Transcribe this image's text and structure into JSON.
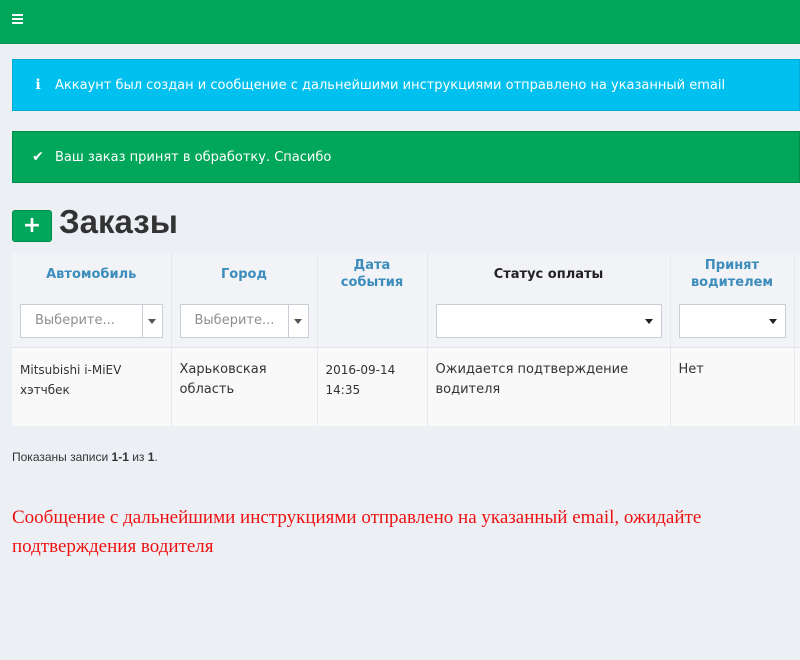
{
  "header": {
    "menu_icon": "hamburger-icon",
    "background": "#00a65a"
  },
  "alerts": {
    "info": {
      "icon": "info-icon",
      "glyph": "ℹ",
      "text": "Аккаунт был создан и сообщение с дальнейшими инструкциями отправлено на указанный email",
      "color": "#00c0ef"
    },
    "success": {
      "icon": "checkmark-icon",
      "glyph": "✔",
      "text": "Ваш заказ принят в обработку. Спасибо",
      "color": "#00a65a"
    }
  },
  "page": {
    "add_glyph": "+",
    "title": "Заказы"
  },
  "table": {
    "columns": [
      {
        "label": "Автомобиль",
        "sortable": true
      },
      {
        "label": "Город",
        "sortable": true
      },
      {
        "label": "Дата события",
        "sortable": true
      },
      {
        "label": "Статус оплаты",
        "sortable": false
      },
      {
        "label": "Принят водителем",
        "sortable": true
      }
    ],
    "filters": {
      "car_placeholder": "Выберите...",
      "city_placeholder": "Выберите...",
      "status_value": "",
      "accepted_value": ""
    },
    "rows": [
      {
        "car": "Mitsubishi i-MiEV хэтчбек",
        "city": "Харьковская область",
        "date": "2016-09-14 14:35",
        "status": "Ожидается подтверждение водителя",
        "accepted": "Нет"
      }
    ]
  },
  "summary": {
    "prefix": "Показаны записи ",
    "range": "1-1",
    "middle": " из ",
    "total": "1",
    "suffix": "."
  },
  "notice": {
    "text": "Сообщение с дальнейшими инструкциями отправлено на указанный email, ожидайте подтверждения водителя",
    "color": "#ee1111"
  }
}
